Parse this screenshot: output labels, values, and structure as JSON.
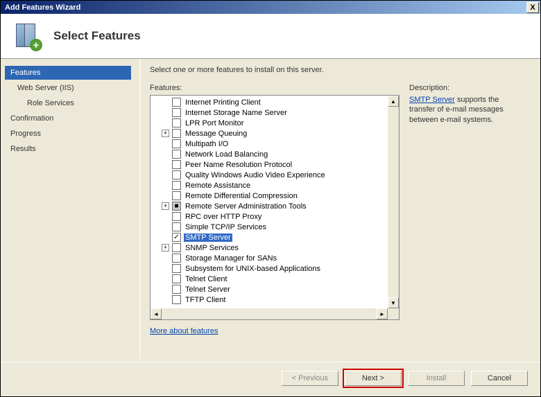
{
  "window": {
    "title": "Add Features Wizard",
    "close": "X"
  },
  "header": {
    "title": "Select Features"
  },
  "sidebar": {
    "items": [
      {
        "label": "Features",
        "selected": true,
        "indent": 0
      },
      {
        "label": "Web Server (IIS)",
        "selected": false,
        "indent": 1
      },
      {
        "label": "Role Services",
        "selected": false,
        "indent": 2
      },
      {
        "label": "Confirmation",
        "selected": false,
        "indent": 0
      },
      {
        "label": "Progress",
        "selected": false,
        "indent": 0
      },
      {
        "label": "Results",
        "selected": false,
        "indent": 0
      }
    ]
  },
  "main": {
    "instruction": "Select one or more features to install on this server.",
    "tree_label": "Features:",
    "tree": [
      {
        "label": "Internet Printing Client",
        "checked": false,
        "indent": 1
      },
      {
        "label": "Internet Storage Name Server",
        "checked": false,
        "indent": 1
      },
      {
        "label": "LPR Port Monitor",
        "checked": false,
        "indent": 1
      },
      {
        "label": "Message Queuing",
        "checked": false,
        "indent": 1,
        "expander": "+"
      },
      {
        "label": "Multipath I/O",
        "checked": false,
        "indent": 1
      },
      {
        "label": "Network Load Balancing",
        "checked": false,
        "indent": 1
      },
      {
        "label": "Peer Name Resolution Protocol",
        "checked": false,
        "indent": 1
      },
      {
        "label": "Quality Windows Audio Video Experience",
        "checked": false,
        "indent": 1
      },
      {
        "label": "Remote Assistance",
        "checked": false,
        "indent": 1
      },
      {
        "label": "Remote Differential Compression",
        "checked": false,
        "indent": 1
      },
      {
        "label": "Remote Server Administration Tools",
        "checked": "tri",
        "indent": 1,
        "expander": "+"
      },
      {
        "label": "RPC over HTTP Proxy",
        "checked": false,
        "indent": 1
      },
      {
        "label": "Simple TCP/IP Services",
        "checked": false,
        "indent": 1
      },
      {
        "label": "SMTP Server",
        "checked": true,
        "indent": 1,
        "selected": true
      },
      {
        "label": "SNMP Services",
        "checked": false,
        "indent": 1,
        "expander": "+"
      },
      {
        "label": "Storage Manager for SANs",
        "checked": false,
        "indent": 1
      },
      {
        "label": "Subsystem for UNIX-based Applications",
        "checked": false,
        "indent": 1
      },
      {
        "label": "Telnet Client",
        "checked": false,
        "indent": 1
      },
      {
        "label": "Telnet Server",
        "checked": false,
        "indent": 1
      },
      {
        "label": "TFTP Client",
        "checked": false,
        "indent": 1
      }
    ],
    "desc_label": "Description:",
    "desc_link": "SMTP Server",
    "desc_text": " supports the transfer of e-mail messages between e-mail systems.",
    "more_link": "More about features"
  },
  "buttons": {
    "previous": "< Previous",
    "next": "Next >",
    "install": "Install",
    "cancel": "Cancel"
  }
}
